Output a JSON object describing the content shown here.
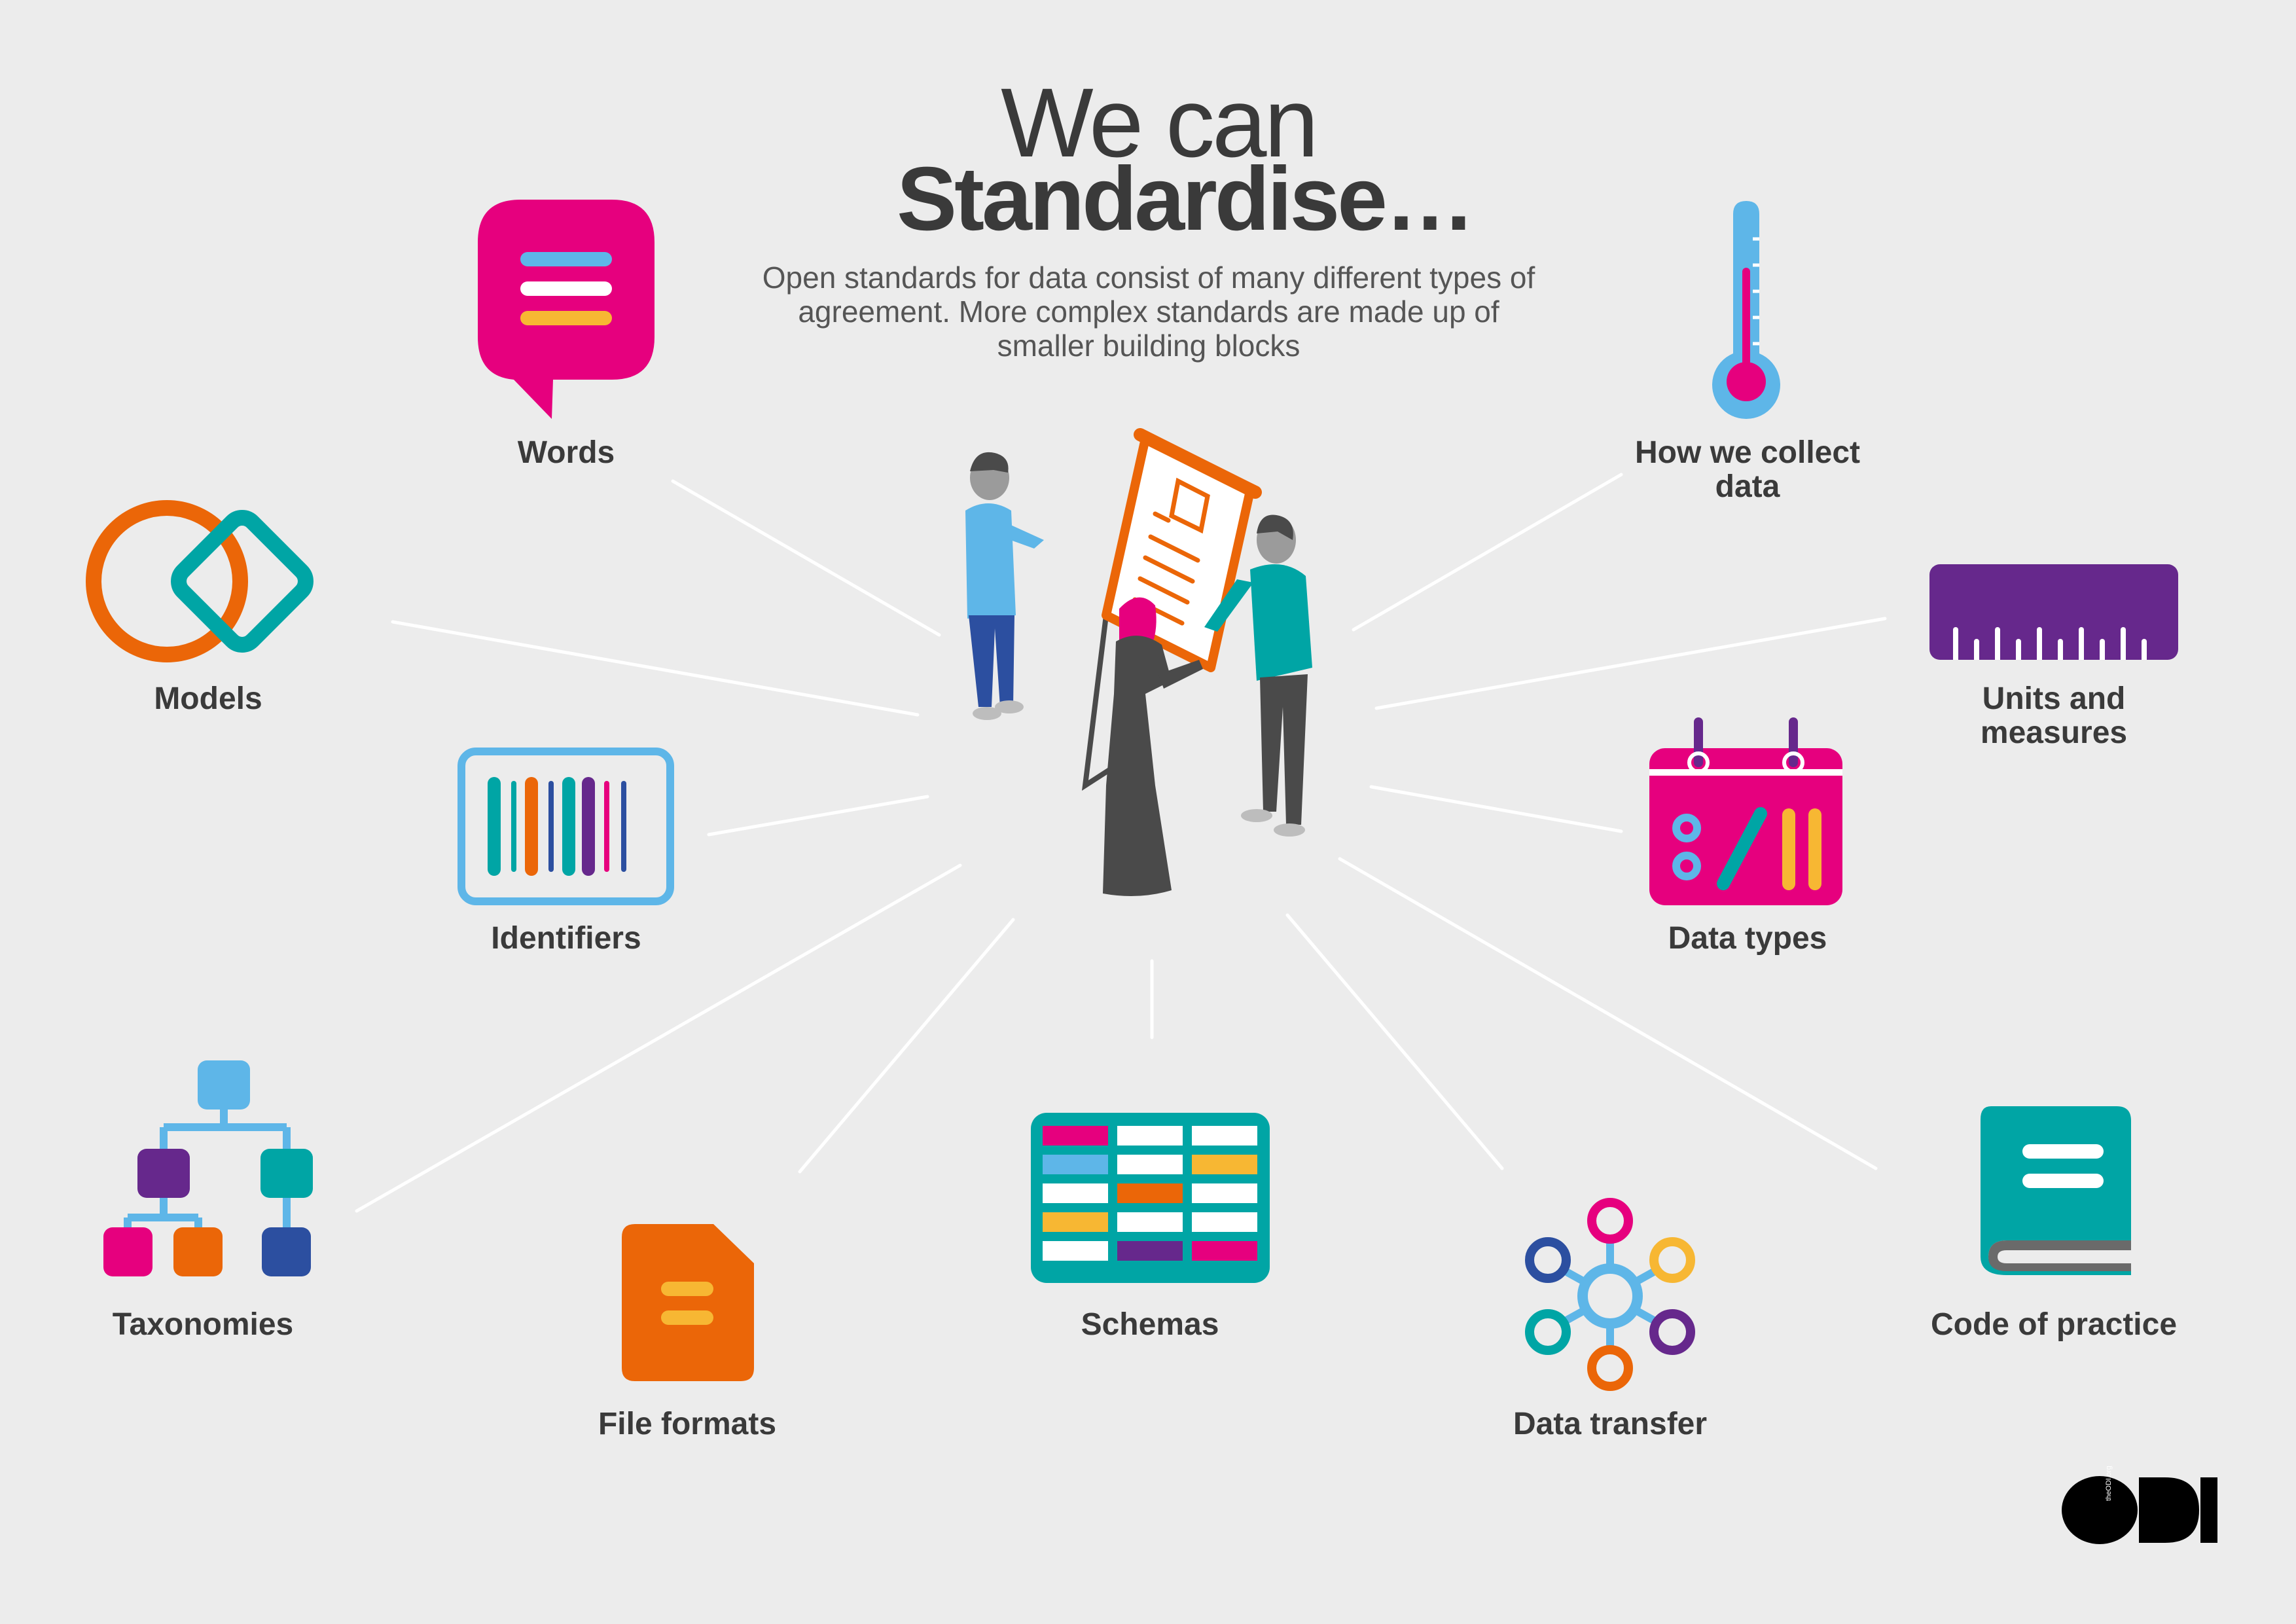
{
  "title_line1": "We can",
  "title_line2": "Standardise…",
  "subtitle": "Open standards for data consist of many different types of agreement. More complex standards are made up of smaller building blocks",
  "items": [
    {
      "label": "Words",
      "icon": "speech-bubble-icon"
    },
    {
      "label": "Models",
      "icon": "overlapping-shapes-icon"
    },
    {
      "label": "Identifiers",
      "icon": "barcode-icon"
    },
    {
      "label": "Taxonomies",
      "icon": "hierarchy-icon"
    },
    {
      "label": "File formats",
      "icon": "document-icon"
    },
    {
      "label": "Schemas",
      "icon": "table-grid-icon"
    },
    {
      "label": "Data transfer",
      "icon": "network-nodes-icon"
    },
    {
      "label": "Code of practice",
      "icon": "book-icon"
    },
    {
      "label": "Data types",
      "icon": "calendar-icon"
    },
    {
      "label": "Units and measures",
      "icon": "ruler-icon"
    },
    {
      "label": "How we collect data",
      "icon": "thermometer-icon"
    }
  ],
  "logo": {
    "text": "ODI",
    "url_text": "theODI.org"
  },
  "colors": {
    "background": "#ececec",
    "magenta": "#e6007e",
    "blue_light": "#5eb6e8",
    "orange": "#eb6608",
    "teal": "#00a5a5",
    "purple": "#66288c",
    "yellow": "#f7b733",
    "navy": "#2c4fa0",
    "dark": "#3a3a3a"
  }
}
